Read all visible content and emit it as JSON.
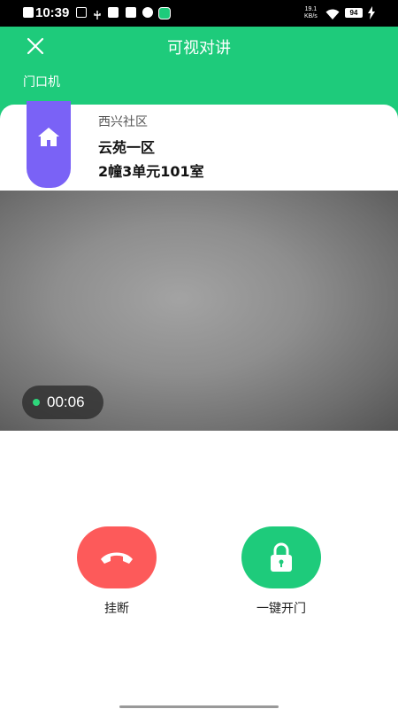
{
  "status_bar": {
    "time": "10:39",
    "speed_value": "19.1",
    "speed_unit": "KB/s",
    "battery": "94"
  },
  "header": {
    "title": "可视对讲",
    "subtitle": "门口机"
  },
  "location": {
    "community": "西兴社区",
    "area": "云苑一区",
    "room": "2幢3单元101室"
  },
  "call": {
    "duration": "00:06"
  },
  "actions": {
    "hangup_label": "挂断",
    "unlock_label": "一键开门"
  },
  "colors": {
    "brand_green": "#1ecb7b",
    "house_purple": "#7a62f6",
    "hangup_red": "#fd5a5a"
  }
}
